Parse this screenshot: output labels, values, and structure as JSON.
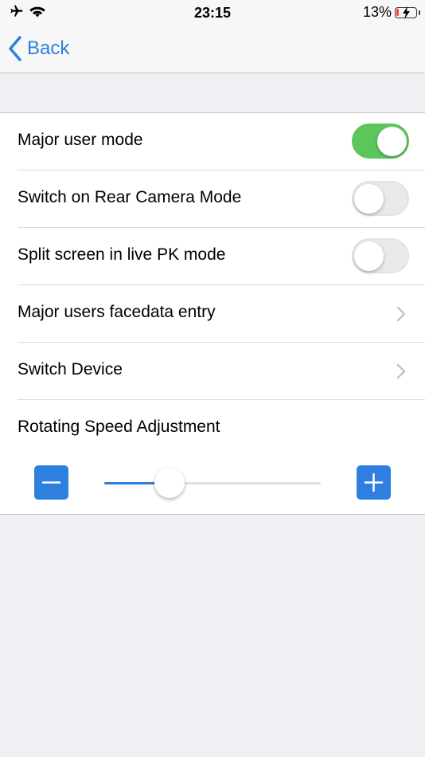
{
  "status_bar": {
    "time": "23:15",
    "battery_percent": "13%",
    "battery_level": 0.13,
    "icons": [
      "airplane-icon",
      "wifi-icon",
      "battery-icon",
      "charging-bolt-icon"
    ]
  },
  "nav": {
    "back_label": "Back"
  },
  "settings": {
    "rows": [
      {
        "label": "Major user mode",
        "control": "toggle",
        "on": true
      },
      {
        "label": "Switch on Rear Camera Mode",
        "control": "toggle",
        "on": false
      },
      {
        "label": "Split screen in live PK mode",
        "control": "toggle",
        "on": false
      },
      {
        "label": "Major users facedata entry",
        "control": "disclosure"
      },
      {
        "label": "Switch Device",
        "control": "disclosure"
      }
    ],
    "rotating_speed": {
      "label": "Rotating Speed Adjustment",
      "value": 0.3,
      "decrease_icon": "minus-icon",
      "increase_icon": "plus-icon"
    }
  },
  "colors": {
    "accent": "#2f7fe0",
    "toggle_on": "#5cc65c",
    "background": "#efeff4",
    "battery_low": "#ff3b30"
  }
}
